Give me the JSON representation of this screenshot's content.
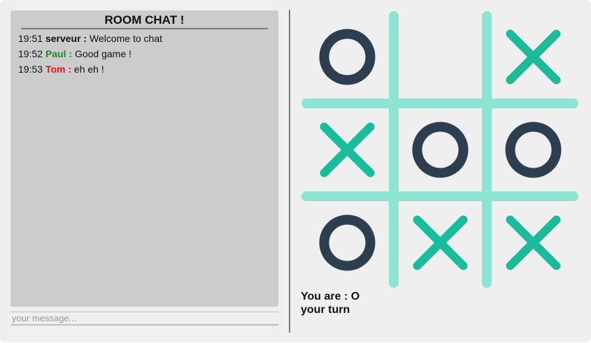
{
  "chat": {
    "title": "ROOM CHAT !",
    "messages": [
      {
        "time": "19:51",
        "author": "serveur :",
        "text": "Welcome to chat",
        "color": "#111111"
      },
      {
        "time": "19:52",
        "author": "Paul :",
        "text": "Good game !",
        "color": "#1e8c1e"
      },
      {
        "time": "19:53",
        "author": "Tom :",
        "text": "eh eh !",
        "color": "#ee1111"
      }
    ],
    "input": {
      "placeholder": "your message...",
      "value": ""
    }
  },
  "game": {
    "board": [
      [
        "O",
        "",
        "X"
      ],
      [
        "X",
        "O",
        "O"
      ],
      [
        "O",
        "X",
        "X"
      ]
    ],
    "player_label": "You are : O",
    "turn_label": "your turn",
    "colors": {
      "grid": "#8ee4d2",
      "x_mark": "#1abc9c",
      "o_mark": "#2c3e50"
    }
  }
}
